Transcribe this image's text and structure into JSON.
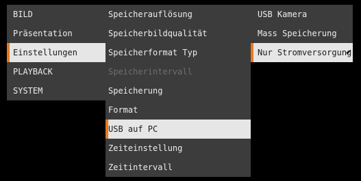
{
  "main_menu": {
    "items": [
      {
        "label": "BILD"
      },
      {
        "label": "Präsentation"
      },
      {
        "label": "Einstellungen"
      },
      {
        "label": "PLAYBACK"
      },
      {
        "label": "SYSTEM"
      }
    ]
  },
  "settings_menu": {
    "items": [
      {
        "label": "Speicherauflösung"
      },
      {
        "label": "Speicherbildqualität"
      },
      {
        "label": "Speicherformat Typ"
      },
      {
        "label": "Speicherintervall"
      },
      {
        "label": "Speicherung"
      },
      {
        "label": "Format"
      },
      {
        "label": "USB auf PC"
      },
      {
        "label": "Zeiteinstellung"
      },
      {
        "label": "Zeitintervall"
      }
    ]
  },
  "usb_menu": {
    "items": [
      {
        "label": "USB Kamera"
      },
      {
        "label": "Mass Speicherung"
      },
      {
        "label": "Nur Stromversorgung"
      }
    ],
    "check_glyph": "✔"
  },
  "accent_color": "#e8791d"
}
